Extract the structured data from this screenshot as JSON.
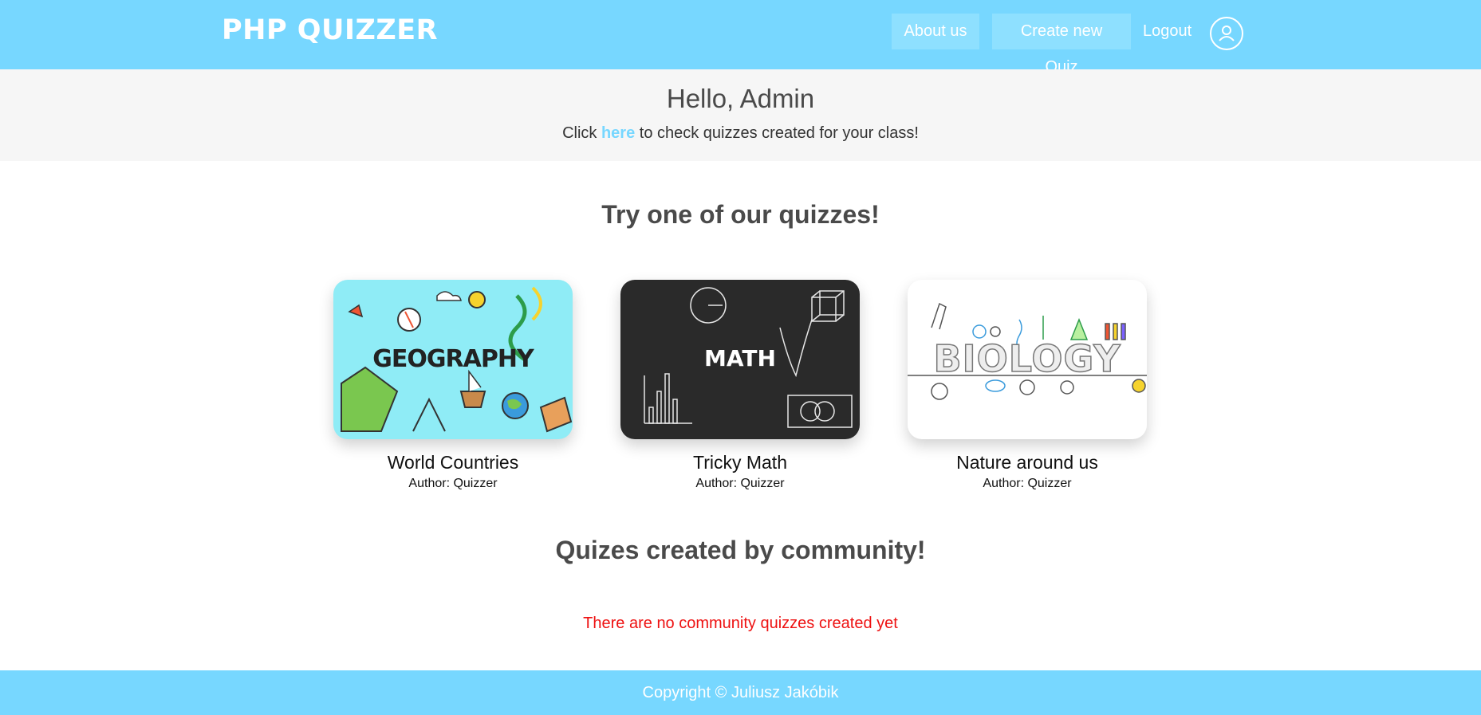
{
  "header": {
    "brand": "PHP QUIZZER",
    "nav": {
      "about": "About us",
      "create": "Create new Quiz",
      "logout": "Logout"
    },
    "avatar_icon": "user-icon"
  },
  "hero": {
    "greeting": "Hello, Admin",
    "sub_before": "Click ",
    "sub_link": "here",
    "sub_after": " to check quizzes created for your class!"
  },
  "featured": {
    "title": "Try one of our quizzes!",
    "cards": [
      {
        "image_word": "GEOGRAPHY",
        "title": "World Countries",
        "author": "Author: Quizzer"
      },
      {
        "image_word": "MATH",
        "title": "Tricky Math",
        "author": "Author: Quizzer"
      },
      {
        "image_word": "BIOLOGY",
        "title": "Nature around us",
        "author": "Author: Quizzer"
      }
    ]
  },
  "community": {
    "title": "Quizes created by community!",
    "empty_message": "There are no community quizzes created yet"
  },
  "footer": {
    "text": "Copyright © Juliusz Jakóbik"
  },
  "colors": {
    "accent": "#77d7ff",
    "error": "#ee1111",
    "hero_bg": "#f6f6f6"
  }
}
